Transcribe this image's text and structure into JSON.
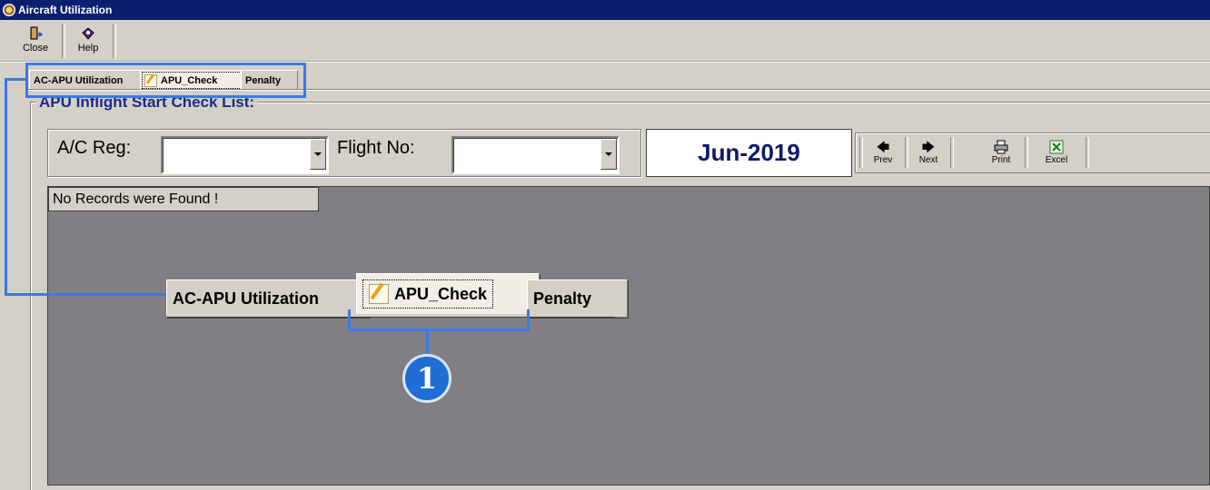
{
  "window": {
    "title": "Aircraft Utilization",
    "icon": "clock-icon"
  },
  "toolbar": {
    "close_label": "Close",
    "help_label": "Help",
    "close_icon": "exit-door-icon",
    "help_icon": "help-book-icon"
  },
  "tabs": [
    {
      "label": "AC-APU Utilization",
      "active": false
    },
    {
      "label": "APU_Check",
      "active": true,
      "icon": "note-pencil-icon"
    },
    {
      "label": "Penalty",
      "active": false
    }
  ],
  "section": {
    "title": "APU Inflight Start Check List:"
  },
  "filters": {
    "ac_reg_label": "A/C Reg:",
    "ac_reg_value": "",
    "flight_no_label": "Flight No:",
    "flight_no_value": ""
  },
  "period": {
    "month": "Jun-2019"
  },
  "nav": {
    "prev_label": "Prev",
    "next_label": "Next",
    "print_label": "Print",
    "excel_label": "Excel"
  },
  "results": {
    "message": "No Records were Found !"
  },
  "callout": {
    "number": "1",
    "tabs": [
      "AC-APU Utilization",
      "APU_Check",
      "Penalty"
    ]
  },
  "colors": {
    "titlebar": "#0b1f6e",
    "panel": "#d4d0c8",
    "results_bg": "#817f83",
    "section_title": "#1f2a86",
    "annotation": "#3b7be0"
  }
}
